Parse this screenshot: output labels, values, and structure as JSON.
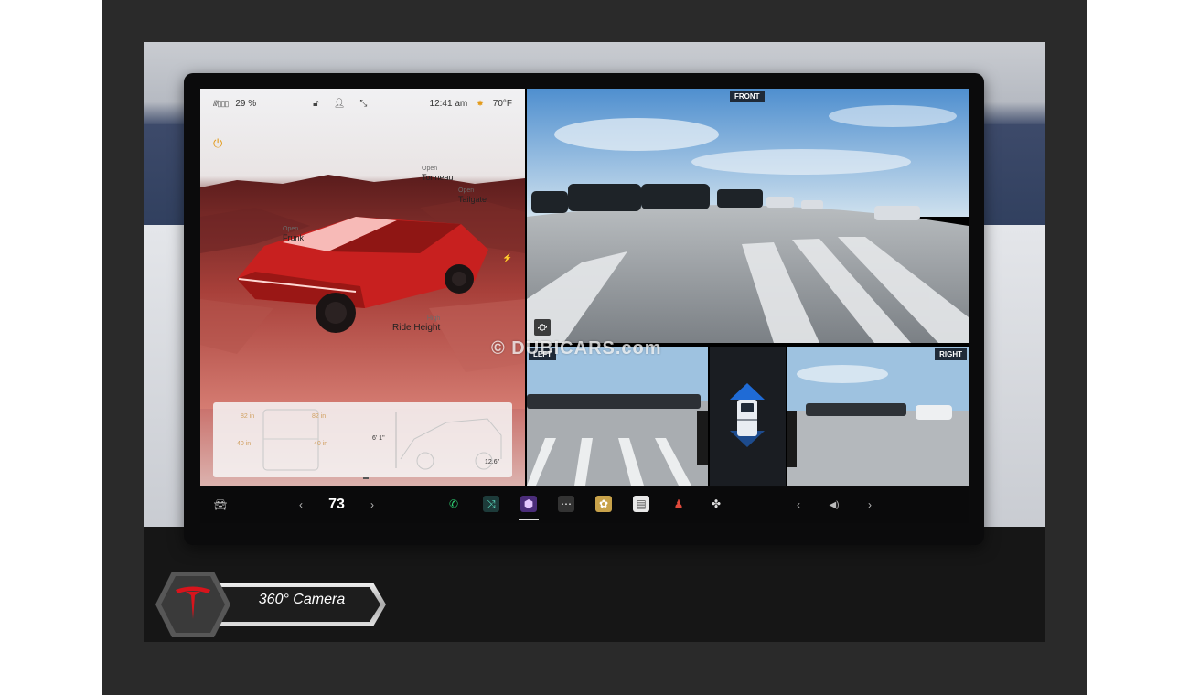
{
  "status": {
    "battery_percent": "29 %",
    "time": "12:41 am",
    "temperature": "70°F"
  },
  "vehicle": {
    "tonneau": {
      "state": "Open",
      "name": "Tonneau"
    },
    "tailgate": {
      "state": "Open",
      "name": "Tailgate"
    },
    "frunk": {
      "state": "Open",
      "name": "Frunk"
    },
    "ride_height": {
      "state": "High",
      "name": "Ride Height"
    },
    "specs": {
      "width1": "82 in",
      "width2": "82 in",
      "track1": "40 in",
      "track2": "40 in",
      "height": "6' 1\"",
      "clearance": "12.6\""
    }
  },
  "cameras": {
    "front_label": "FRONT",
    "left_label": "LEFT",
    "right_label": "RIGHT"
  },
  "taskbar": {
    "cabin_temp": "73"
  },
  "badge": {
    "text": "360° Camera"
  },
  "watermark": "© DUBICARS.com",
  "colors": {
    "accent_orange": "#e39a1a",
    "truck_red": "#c8201f",
    "camera_label_bg": "#1f2a38",
    "sky_blue": "#5d9bd5",
    "tesla_red": "#d8141c"
  },
  "icons": {
    "car": "car-icon",
    "phone": "phone-icon",
    "shuffle": "shuffle-icon",
    "app": "app-icon",
    "more": "more-icon",
    "photos": "photos-icon",
    "calendar": "calendar-icon",
    "joystick": "joystick-icon",
    "fan": "fan-icon",
    "volume": "volume-icon"
  }
}
